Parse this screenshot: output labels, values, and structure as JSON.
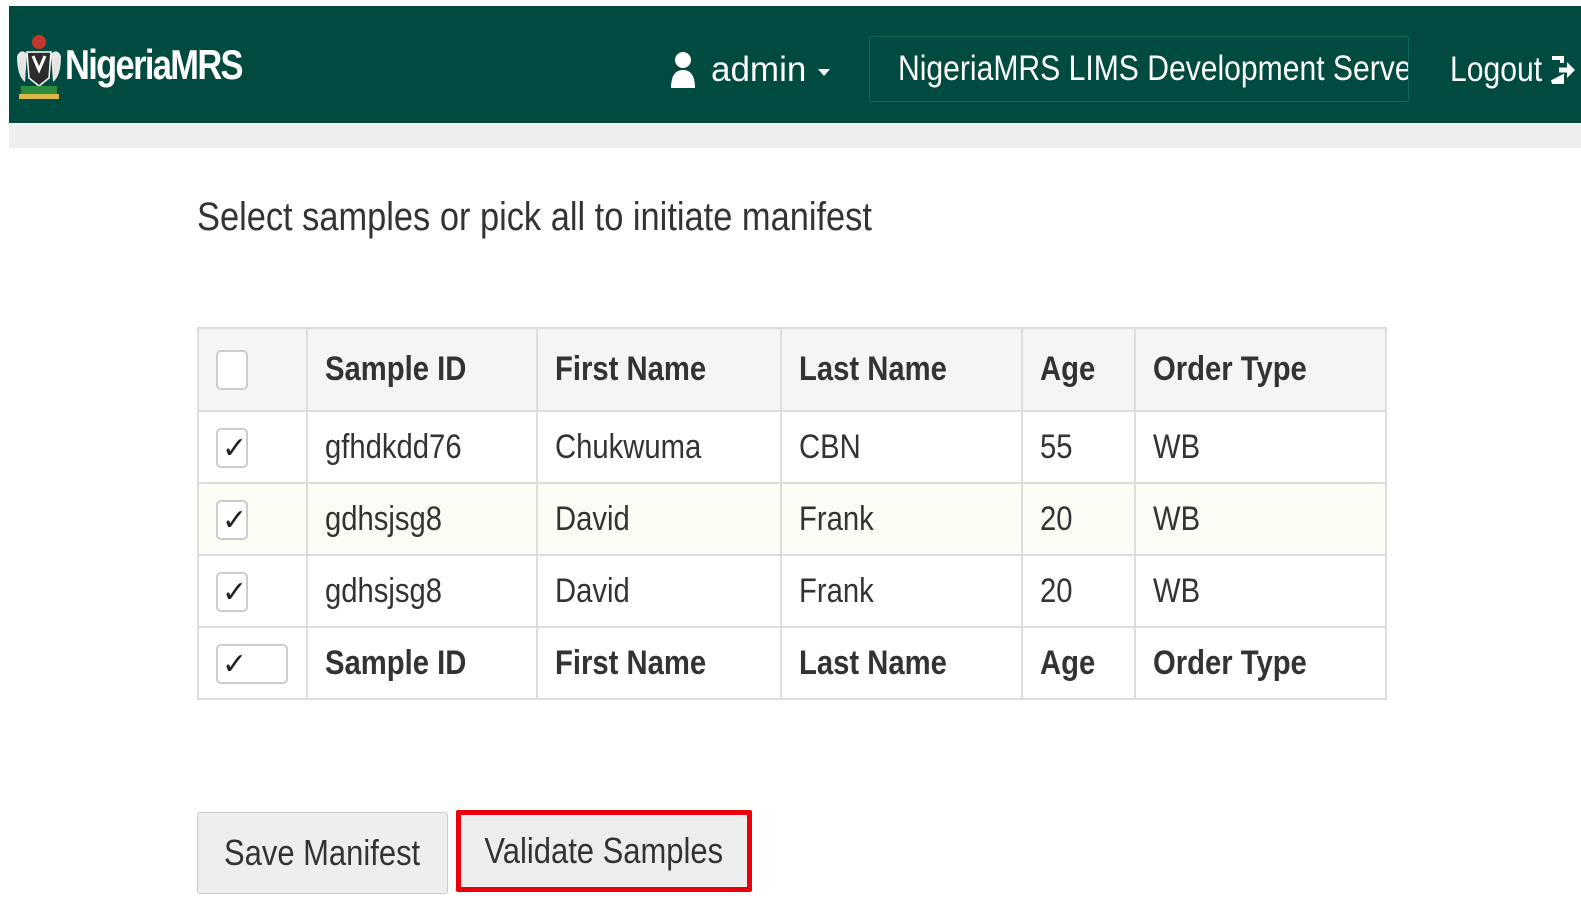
{
  "header": {
    "brand": "NigeriaMRS",
    "user": "admin",
    "server": "NigeriaMRS LIMS Development Server",
    "logout": "Logout"
  },
  "page": {
    "title": "Select samples or pick all to initiate manifest"
  },
  "table": {
    "columns": [
      "Sample ID",
      "First Name",
      "Last Name",
      "Age",
      "Order Type"
    ],
    "rows": [
      {
        "checked": true,
        "sample_id": "gfhdkdd76",
        "first_name": "Chukwuma",
        "last_name": "CBN",
        "age": "55",
        "order_type": "WB"
      },
      {
        "checked": true,
        "sample_id": "gdhsjsg8",
        "first_name": "David",
        "last_name": "Frank",
        "age": "20",
        "order_type": "WB"
      },
      {
        "checked": true,
        "sample_id": "gdhsjsg8",
        "first_name": "David",
        "last_name": "Frank",
        "age": "20",
        "order_type": "WB"
      }
    ],
    "header_select_all_checked": false,
    "footer_select_all_checked": true
  },
  "buttons": {
    "save": "Save Manifest",
    "validate": "Validate Samples"
  },
  "icons": {
    "emblem": "coat-of-arms-icon",
    "user": "user-icon",
    "pin": "map-marker-icon",
    "logout": "logout-icon",
    "caret": "caret-down-icon"
  },
  "colors": {
    "navbar": "#004a40",
    "highlight": "#e8000b"
  }
}
